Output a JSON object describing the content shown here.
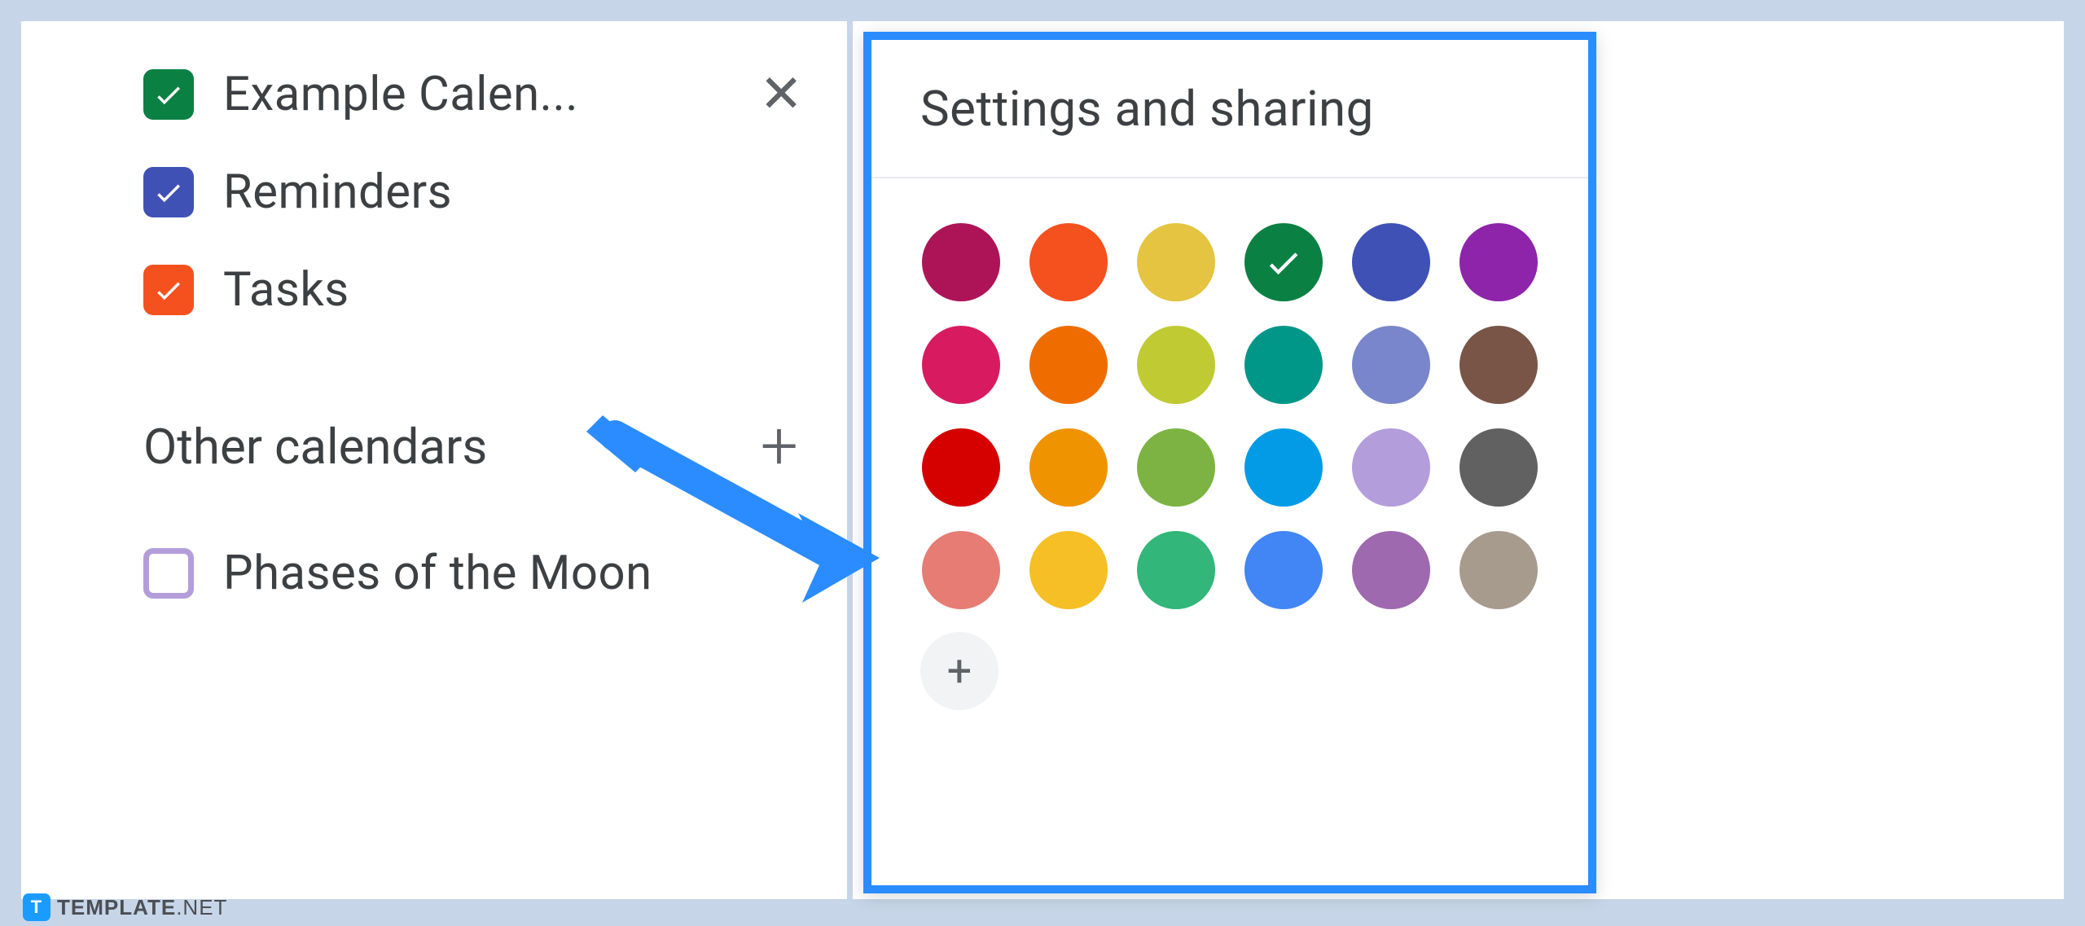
{
  "sidebar": {
    "calendars": [
      {
        "label": "Example Calen...",
        "color": "#0b8043",
        "checked": true,
        "hasClose": true
      },
      {
        "label": "Reminders",
        "color": "#3f51b5",
        "checked": true,
        "hasClose": false
      },
      {
        "label": "Tasks",
        "color": "#f4511e",
        "checked": true,
        "hasClose": false
      }
    ],
    "section_label": "Other calendars",
    "other_calendars": [
      {
        "label": "Phases of the Moon",
        "color": "#b39ddb",
        "checked": false
      }
    ]
  },
  "popover": {
    "title": "Settings and sharing",
    "selected_color": "#0b8043",
    "colors": [
      "#ad1457",
      "#f4511e",
      "#e4c441",
      "#0b8043",
      "#3f51b5",
      "#8e24aa",
      "#d81b60",
      "#ef6c00",
      "#c0ca33",
      "#009688",
      "#7986cb",
      "#795548",
      "#d50000",
      "#f09300",
      "#7cb342",
      "#039be5",
      "#b39ddb",
      "#616161",
      "#e67c73",
      "#f6bf26",
      "#33b679",
      "#4285f4",
      "#9e69af",
      "#a79b8e"
    ]
  },
  "watermark": {
    "prefix": "TEMPLATE",
    "suffix": ".NET"
  }
}
